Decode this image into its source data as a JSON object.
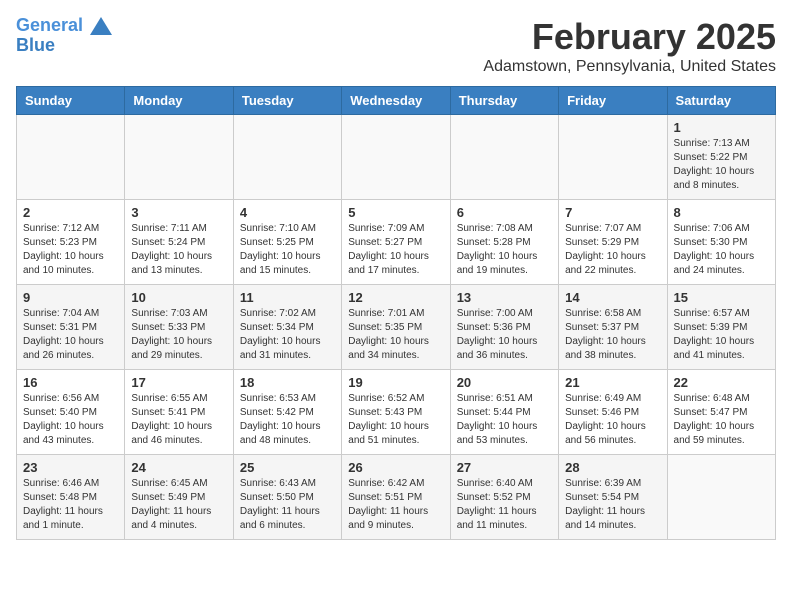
{
  "logo": {
    "line1": "General",
    "line2": "Blue"
  },
  "title": "February 2025",
  "subtitle": "Adamstown, Pennsylvania, United States",
  "days_of_week": [
    "Sunday",
    "Monday",
    "Tuesday",
    "Wednesday",
    "Thursday",
    "Friday",
    "Saturday"
  ],
  "weeks": [
    [
      {
        "day": "",
        "info": ""
      },
      {
        "day": "",
        "info": ""
      },
      {
        "day": "",
        "info": ""
      },
      {
        "day": "",
        "info": ""
      },
      {
        "day": "",
        "info": ""
      },
      {
        "day": "",
        "info": ""
      },
      {
        "day": "1",
        "info": "Sunrise: 7:13 AM\nSunset: 5:22 PM\nDaylight: 10 hours\nand 8 minutes."
      }
    ],
    [
      {
        "day": "2",
        "info": "Sunrise: 7:12 AM\nSunset: 5:23 PM\nDaylight: 10 hours\nand 10 minutes."
      },
      {
        "day": "3",
        "info": "Sunrise: 7:11 AM\nSunset: 5:24 PM\nDaylight: 10 hours\nand 13 minutes."
      },
      {
        "day": "4",
        "info": "Sunrise: 7:10 AM\nSunset: 5:25 PM\nDaylight: 10 hours\nand 15 minutes."
      },
      {
        "day": "5",
        "info": "Sunrise: 7:09 AM\nSunset: 5:27 PM\nDaylight: 10 hours\nand 17 minutes."
      },
      {
        "day": "6",
        "info": "Sunrise: 7:08 AM\nSunset: 5:28 PM\nDaylight: 10 hours\nand 19 minutes."
      },
      {
        "day": "7",
        "info": "Sunrise: 7:07 AM\nSunset: 5:29 PM\nDaylight: 10 hours\nand 22 minutes."
      },
      {
        "day": "8",
        "info": "Sunrise: 7:06 AM\nSunset: 5:30 PM\nDaylight: 10 hours\nand 24 minutes."
      }
    ],
    [
      {
        "day": "9",
        "info": "Sunrise: 7:04 AM\nSunset: 5:31 PM\nDaylight: 10 hours\nand 26 minutes."
      },
      {
        "day": "10",
        "info": "Sunrise: 7:03 AM\nSunset: 5:33 PM\nDaylight: 10 hours\nand 29 minutes."
      },
      {
        "day": "11",
        "info": "Sunrise: 7:02 AM\nSunset: 5:34 PM\nDaylight: 10 hours\nand 31 minutes."
      },
      {
        "day": "12",
        "info": "Sunrise: 7:01 AM\nSunset: 5:35 PM\nDaylight: 10 hours\nand 34 minutes."
      },
      {
        "day": "13",
        "info": "Sunrise: 7:00 AM\nSunset: 5:36 PM\nDaylight: 10 hours\nand 36 minutes."
      },
      {
        "day": "14",
        "info": "Sunrise: 6:58 AM\nSunset: 5:37 PM\nDaylight: 10 hours\nand 38 minutes."
      },
      {
        "day": "15",
        "info": "Sunrise: 6:57 AM\nSunset: 5:39 PM\nDaylight: 10 hours\nand 41 minutes."
      }
    ],
    [
      {
        "day": "16",
        "info": "Sunrise: 6:56 AM\nSunset: 5:40 PM\nDaylight: 10 hours\nand 43 minutes."
      },
      {
        "day": "17",
        "info": "Sunrise: 6:55 AM\nSunset: 5:41 PM\nDaylight: 10 hours\nand 46 minutes."
      },
      {
        "day": "18",
        "info": "Sunrise: 6:53 AM\nSunset: 5:42 PM\nDaylight: 10 hours\nand 48 minutes."
      },
      {
        "day": "19",
        "info": "Sunrise: 6:52 AM\nSunset: 5:43 PM\nDaylight: 10 hours\nand 51 minutes."
      },
      {
        "day": "20",
        "info": "Sunrise: 6:51 AM\nSunset: 5:44 PM\nDaylight: 10 hours\nand 53 minutes."
      },
      {
        "day": "21",
        "info": "Sunrise: 6:49 AM\nSunset: 5:46 PM\nDaylight: 10 hours\nand 56 minutes."
      },
      {
        "day": "22",
        "info": "Sunrise: 6:48 AM\nSunset: 5:47 PM\nDaylight: 10 hours\nand 59 minutes."
      }
    ],
    [
      {
        "day": "23",
        "info": "Sunrise: 6:46 AM\nSunset: 5:48 PM\nDaylight: 11 hours\nand 1 minute."
      },
      {
        "day": "24",
        "info": "Sunrise: 6:45 AM\nSunset: 5:49 PM\nDaylight: 11 hours\nand 4 minutes."
      },
      {
        "day": "25",
        "info": "Sunrise: 6:43 AM\nSunset: 5:50 PM\nDaylight: 11 hours\nand 6 minutes."
      },
      {
        "day": "26",
        "info": "Sunrise: 6:42 AM\nSunset: 5:51 PM\nDaylight: 11 hours\nand 9 minutes."
      },
      {
        "day": "27",
        "info": "Sunrise: 6:40 AM\nSunset: 5:52 PM\nDaylight: 11 hours\nand 11 minutes."
      },
      {
        "day": "28",
        "info": "Sunrise: 6:39 AM\nSunset: 5:54 PM\nDaylight: 11 hours\nand 14 minutes."
      },
      {
        "day": "",
        "info": ""
      }
    ]
  ]
}
